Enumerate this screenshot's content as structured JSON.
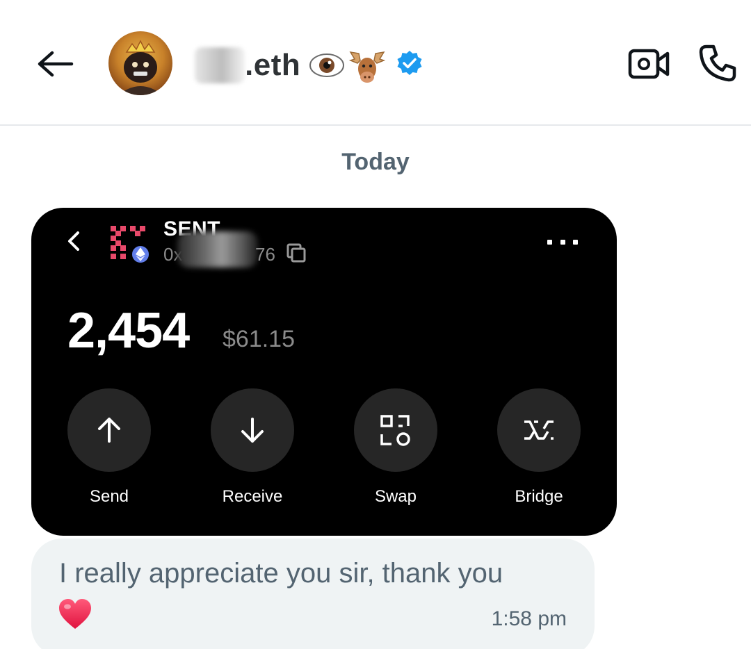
{
  "header": {
    "name_suffix": ".eth",
    "emoji": [
      "eye-emoji",
      "moose-emoji"
    ],
    "verified_color": "#1d9bf0"
  },
  "date_divider": "Today",
  "wallet_screenshot": {
    "token_name": "SENT",
    "address_prefix": "0x",
    "address_suffix": "76",
    "balance": "2,454",
    "balance_usd": "$61.15",
    "actions": [
      {
        "label": "Send",
        "icon": "arrow-up-icon"
      },
      {
        "label": "Receive",
        "icon": "arrow-down-icon"
      },
      {
        "label": "Swap",
        "icon": "swap-icon"
      },
      {
        "label": "Bridge",
        "icon": "bridge-icon"
      }
    ],
    "logo_color": "#e8496a",
    "eth_badge_color": "#627eea"
  },
  "message": {
    "text": "I really appreciate you sir, thank you",
    "time": "1:58 pm"
  }
}
